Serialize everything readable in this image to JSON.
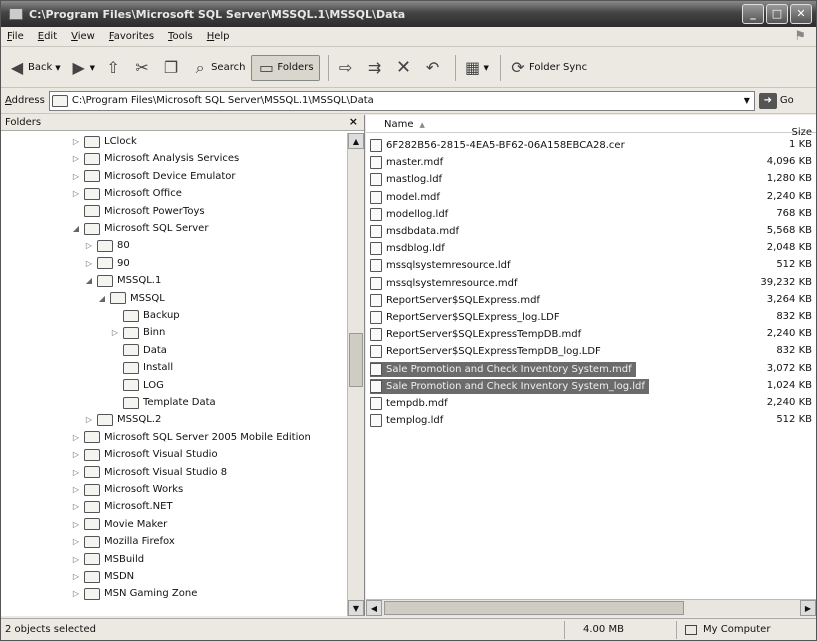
{
  "window": {
    "title": "C:\\Program Files\\Microsoft SQL Server\\MSSQL.1\\MSSQL\\Data",
    "minimize_label": "_",
    "maximize_label": "□",
    "close_label": "✕"
  },
  "menu": [
    "File",
    "Edit",
    "View",
    "Favorites",
    "Tools",
    "Help"
  ],
  "toolbar": {
    "back": "Back",
    "search": "Search",
    "folders": "Folders",
    "folder_sync": "Folder Sync"
  },
  "address": {
    "label": "Address",
    "value": "C:\\Program Files\\Microsoft SQL Server\\MSSQL.1\\MSSQL\\Data",
    "go": "Go"
  },
  "folders_pane": {
    "title": "Folders",
    "close": "×",
    "tree": [
      {
        "label": "LClock",
        "level": 1,
        "expander": "collapsed"
      },
      {
        "label": "Microsoft Analysis Services",
        "level": 1,
        "expander": "collapsed"
      },
      {
        "label": "Microsoft Device Emulator",
        "level": 1,
        "expander": "collapsed"
      },
      {
        "label": "Microsoft Office",
        "level": 1,
        "expander": "collapsed"
      },
      {
        "label": "Microsoft PowerToys",
        "level": 1,
        "expander": "none"
      },
      {
        "label": "Microsoft SQL Server",
        "level": 1,
        "expander": "expanded"
      },
      {
        "label": "80",
        "level": 2,
        "expander": "collapsed"
      },
      {
        "label": "90",
        "level": 2,
        "expander": "collapsed"
      },
      {
        "label": "MSSQL.1",
        "level": 2,
        "expander": "expanded"
      },
      {
        "label": "MSSQL",
        "level": 3,
        "expander": "expanded"
      },
      {
        "label": "Backup",
        "level": 4,
        "expander": "none"
      },
      {
        "label": "Binn",
        "level": 4,
        "expander": "collapsed"
      },
      {
        "label": "Data",
        "level": 4,
        "expander": "none"
      },
      {
        "label": "Install",
        "level": 4,
        "expander": "none"
      },
      {
        "label": "LOG",
        "level": 4,
        "expander": "none"
      },
      {
        "label": "Template Data",
        "level": 4,
        "expander": "none"
      },
      {
        "label": "MSSQL.2",
        "level": 2,
        "expander": "collapsed"
      },
      {
        "label": "Microsoft SQL Server 2005 Mobile Edition",
        "level": 1,
        "expander": "collapsed"
      },
      {
        "label": "Microsoft Visual Studio",
        "level": 1,
        "expander": "collapsed"
      },
      {
        "label": "Microsoft Visual Studio 8",
        "level": 1,
        "expander": "collapsed"
      },
      {
        "label": "Microsoft Works",
        "level": 1,
        "expander": "collapsed"
      },
      {
        "label": "Microsoft.NET",
        "level": 1,
        "expander": "collapsed"
      },
      {
        "label": "Movie Maker",
        "level": 1,
        "expander": "collapsed"
      },
      {
        "label": "Mozilla Firefox",
        "level": 1,
        "expander": "collapsed"
      },
      {
        "label": "MSBuild",
        "level": 1,
        "expander": "collapsed"
      },
      {
        "label": "MSDN",
        "level": 1,
        "expander": "collapsed"
      },
      {
        "label": "MSN Gaming Zone",
        "level": 1,
        "expander": "collapsed"
      }
    ]
  },
  "files_pane": {
    "columns": {
      "name": "Name",
      "size": "Size"
    },
    "files": [
      {
        "name": "6F282B56-2815-4EA5-BF62-06A158EBCA28.cer",
        "size": "1 KB",
        "selected": false
      },
      {
        "name": "master.mdf",
        "size": "4,096 KB",
        "selected": false
      },
      {
        "name": "mastlog.ldf",
        "size": "1,280 KB",
        "selected": false
      },
      {
        "name": "model.mdf",
        "size": "2,240 KB",
        "selected": false
      },
      {
        "name": "modellog.ldf",
        "size": "768 KB",
        "selected": false
      },
      {
        "name": "msdbdata.mdf",
        "size": "5,568 KB",
        "selected": false
      },
      {
        "name": "msdblog.ldf",
        "size": "2,048 KB",
        "selected": false
      },
      {
        "name": "mssqlsystemresource.ldf",
        "size": "512 KB",
        "selected": false
      },
      {
        "name": "mssqlsystemresource.mdf",
        "size": "39,232 KB",
        "selected": false
      },
      {
        "name": "ReportServer$SQLExpress.mdf",
        "size": "3,264 KB",
        "selected": false
      },
      {
        "name": "ReportServer$SQLExpress_log.LDF",
        "size": "832 KB",
        "selected": false
      },
      {
        "name": "ReportServer$SQLExpressTempDB.mdf",
        "size": "2,240 KB",
        "selected": false
      },
      {
        "name": "ReportServer$SQLExpressTempDB_log.LDF",
        "size": "832 KB",
        "selected": false
      },
      {
        "name": "Sale Promotion and Check Inventory System.mdf",
        "size": "3,072 KB",
        "selected": true
      },
      {
        "name": "Sale Promotion and Check Inventory System_log.ldf",
        "size": "1,024 KB",
        "selected": true
      },
      {
        "name": "tempdb.mdf",
        "size": "2,240 KB",
        "selected": false
      },
      {
        "name": "templog.ldf",
        "size": "512 KB",
        "selected": false
      }
    ]
  },
  "status": {
    "selection": "2 objects selected",
    "size": "4.00 MB",
    "location": "My Computer"
  }
}
